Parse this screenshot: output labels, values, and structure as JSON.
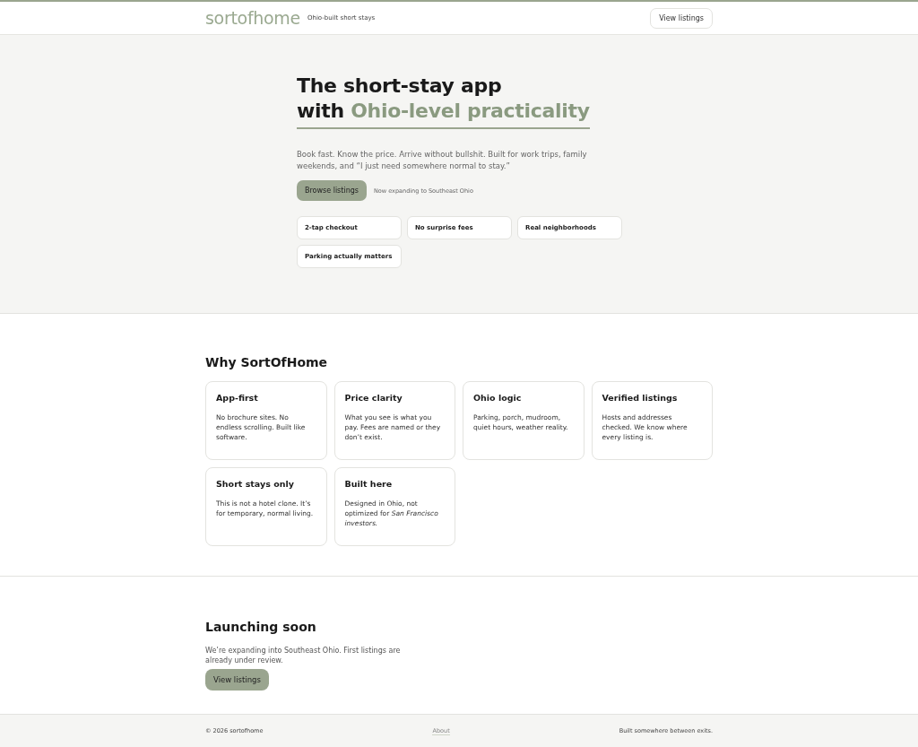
{
  "header": {
    "logo": "sortofhome",
    "tagline": "Ohio-built short stays",
    "button": "View listings"
  },
  "hero": {
    "title_line1": "The short-stay app",
    "title_prefix": "with ",
    "title_accent": "Ohio-level practicality",
    "lead": "Book fast. Know the price. Arrive without bullshit. Built for work trips, family weekends, and “I just need somewhere normal to stay.”",
    "button": "Browse listings",
    "note": "Now expanding to Southeast Ohio",
    "chips": [
      "2-tap checkout",
      "No surprise fees",
      "Real neighborhoods",
      "Parking actually matters"
    ]
  },
  "why": {
    "title": "Why SortOfHome",
    "cards": [
      {
        "title": "App-first",
        "body": "No brochure sites. No endless scrolling. Built like software."
      },
      {
        "title": "Price clarity",
        "body": "What you see is what you pay. Fees are named or they don’t exist."
      },
      {
        "title": "Ohio logic",
        "body": "Parking, porch, mudroom, quiet hours, weather reality."
      },
      {
        "title": "Verified listings",
        "body": "Hosts and addresses checked. We know where every listing is."
      },
      {
        "title": "Short stays only",
        "body": "This is not a hotel clone. It’s for temporary, normal living."
      },
      {
        "title": "Built here",
        "body": "Designed in Ohio, not optimized for *San Francisco investors.*"
      }
    ]
  },
  "launch": {
    "title": "Launching soon",
    "text": "We’re expanding into Southeast Ohio. First listings are already under review.",
    "button": "View listings"
  },
  "footer": {
    "copyright": "© 2026 sortofhome",
    "link": "About",
    "tagline": "Built somewhere between exits."
  }
}
